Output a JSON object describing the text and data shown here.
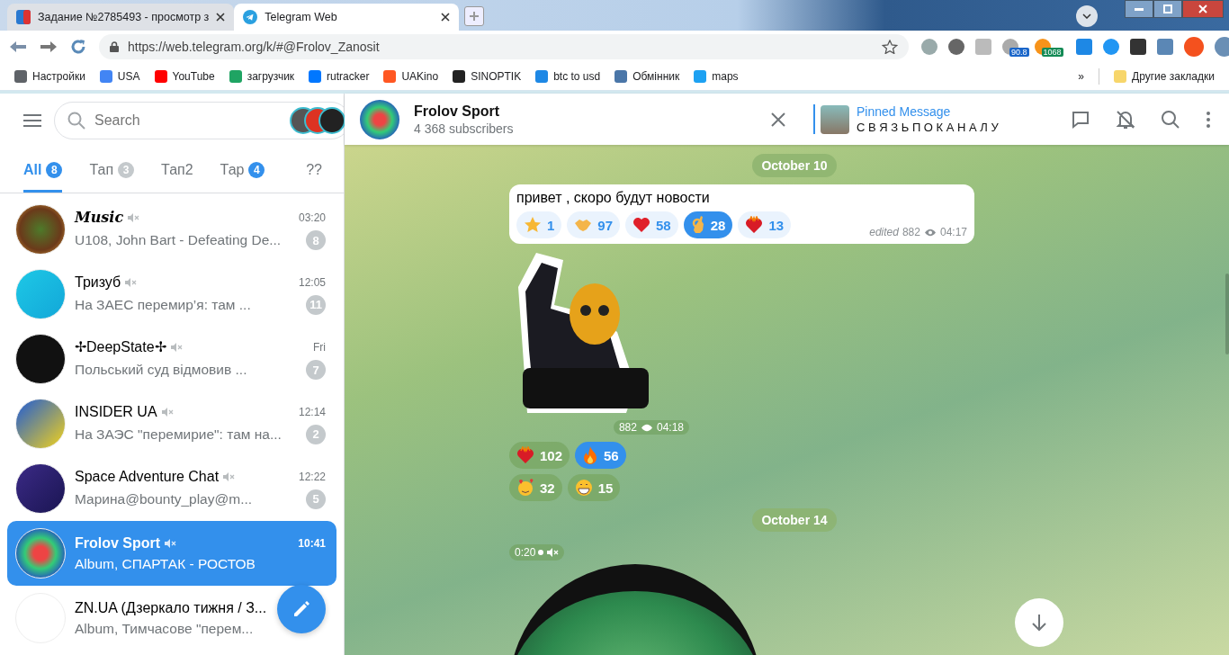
{
  "browser": {
    "tabs": [
      {
        "title": "Задание №2785493 - просмотр з",
        "selected": false
      },
      {
        "title": "Telegram Web",
        "selected": true
      }
    ],
    "url": "https://web.telegram.org/k/#@Frolov_Zanosit",
    "extension_badges": [
      "90.8",
      "1068"
    ],
    "bookmarks": [
      "Настройки",
      "USA",
      "YouTube",
      "загрузчик",
      "rutracker",
      "UAKino",
      "SINOPTIK",
      "btc to usd",
      "Обмінник",
      "maps"
    ],
    "more_bookmarks": "»",
    "other_bookmarks": "Другие закладки"
  },
  "sidebar": {
    "search": {
      "placeholder": "Search"
    },
    "folders": [
      {
        "label": "All",
        "count": "8",
        "muted": false,
        "selected": true
      },
      {
        "label": "Тап",
        "count": "3",
        "muted": true,
        "selected": false
      },
      {
        "label": "Тап2",
        "selected": false
      },
      {
        "label": "Тар",
        "count": "4",
        "muted": false,
        "selected": false
      },
      {
        "label": "??",
        "selected": false
      }
    ],
    "chats": [
      {
        "name": "Music",
        "time": "03:20",
        "preview": "U108, John Bart - Defeating De...",
        "unread": "8",
        "muted": true,
        "selected": false
      },
      {
        "name": "Тризуб",
        "time": "12:05",
        "preview": "На ЗАЕС перемир’я: там ...",
        "unread": "11",
        "muted": true,
        "selected": false
      },
      {
        "name": "✢DeepState✢",
        "time": "Fri",
        "preview": "Польський суд відмовив ...",
        "unread": "7",
        "muted": true,
        "selected": false
      },
      {
        "name": "INSIDER UA",
        "time": "12:14",
        "preview": "На ЗАЭС \"перемирие\": там на...",
        "unread": "2",
        "muted": true,
        "selected": false
      },
      {
        "name": "Space Adventure Chat",
        "time": "12:22",
        "preview": "Марина@bounty_play@m...",
        "unread": "5",
        "muted": true,
        "selected": false
      },
      {
        "name": "Frolov Sport",
        "time": "10:41",
        "preview": "Album, СПАРТАК - РОСТОВ",
        "muted": true,
        "selected": true
      },
      {
        "name": "ZN.UA (Дзеркало тижня / З...",
        "preview": "Album, Тимчасове \"перем...",
        "muted": false,
        "selected": false
      }
    ]
  },
  "chat": {
    "title": "Frolov Sport",
    "subtitle": "4 368 subscribers",
    "pinned": {
      "title": "Pinned Message",
      "text": "С В Я З Ь П О К А Н А Л У"
    },
    "messages": [
      {
        "kind": "date",
        "text": "October 10"
      },
      {
        "kind": "text",
        "text": "привет , скоро будут новости",
        "edited": "edited",
        "views": "882",
        "time": "04:17",
        "reactions": [
          {
            "kind": "star",
            "count": "1",
            "selected": false
          },
          {
            "kind": "handshake",
            "count": "97",
            "selected": false
          },
          {
            "kind": "heart",
            "count": "58",
            "selected": false
          },
          {
            "kind": "ok",
            "count": "28",
            "selected": true
          },
          {
            "kind": "heartfire",
            "count": "13",
            "selected": false
          }
        ]
      },
      {
        "kind": "sticker",
        "views": "882",
        "time": "04:18",
        "reactions": [
          {
            "kind": "heartfire",
            "count": "102",
            "selected": false
          },
          {
            "kind": "fire",
            "count": "56",
            "selected": true
          },
          {
            "kind": "hearts",
            "count": "32",
            "selected": false
          },
          {
            "kind": "grin",
            "count": "15",
            "selected": false
          }
        ]
      },
      {
        "kind": "date",
        "text": "October 14"
      },
      {
        "kind": "video",
        "duration": "0:20"
      }
    ]
  }
}
